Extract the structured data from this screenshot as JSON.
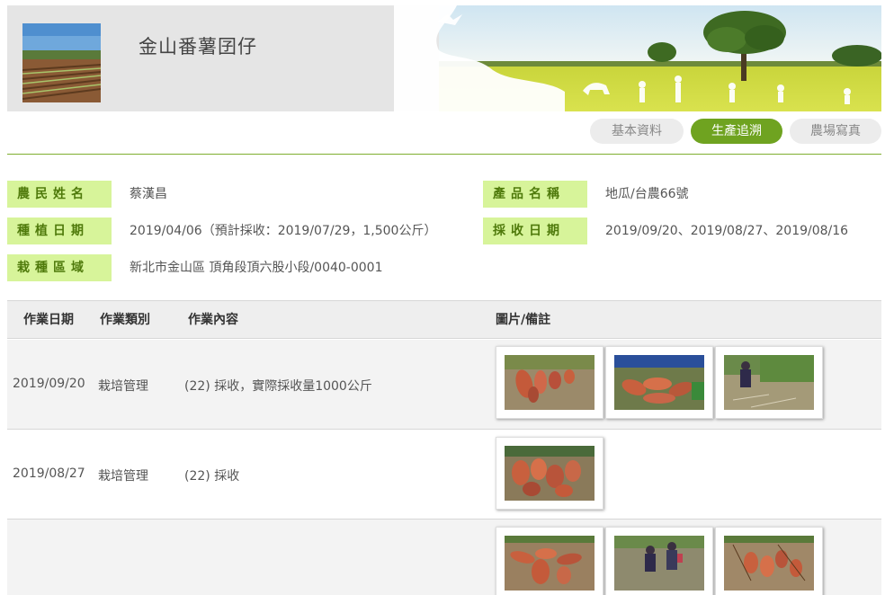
{
  "farm": {
    "name": "金山番薯囝仔"
  },
  "tabs": [
    {
      "label": "基本資料",
      "active": false
    },
    {
      "label": "生產追溯",
      "active": true
    },
    {
      "label": "農場寫真",
      "active": false
    }
  ],
  "info": {
    "farmer_label": "農民姓名",
    "farmer_value": "蔡漢昌",
    "product_label": "產品名稱",
    "product_value": "地瓜/台農66號",
    "plant_date_label": "種植日期",
    "plant_date_value": "2019/04/06（預計採收：2019/07/29，1,500公斤）",
    "harvest_date_label": "採收日期",
    "harvest_date_value": "2019/09/20、2019/08/27、2019/08/16",
    "area_label": "栽種區域",
    "area_value": "新北市金山區 頂角段頂六股小段/0040-0001"
  },
  "table": {
    "headers": [
      "作業日期",
      "作業類別",
      "作業內容",
      "圖片/備註"
    ],
    "rows": [
      {
        "date": "2019/09/20",
        "type": "栽培管理",
        "content": "(22) 採收，實際採收量1000公斤",
        "photos": [
          "sweet-potato-pile-photo",
          "sweet-potato-crate-photo",
          "farmer-harvesting-photo"
        ]
      },
      {
        "date": "2019/08/27",
        "type": "栽培管理",
        "content": "(22) 採收",
        "photos": [
          "sweet-potato-pile-photo"
        ]
      },
      {
        "date": "",
        "type": "",
        "content": "",
        "photos": [
          "sweet-potato-pile-photo",
          "farmer-harvesting-photo",
          "sweet-potato-field-photo"
        ]
      }
    ]
  },
  "colors": {
    "accent": "#6fa320",
    "label_bg": "#d7f49a",
    "label_text": "#4f7a0b"
  }
}
